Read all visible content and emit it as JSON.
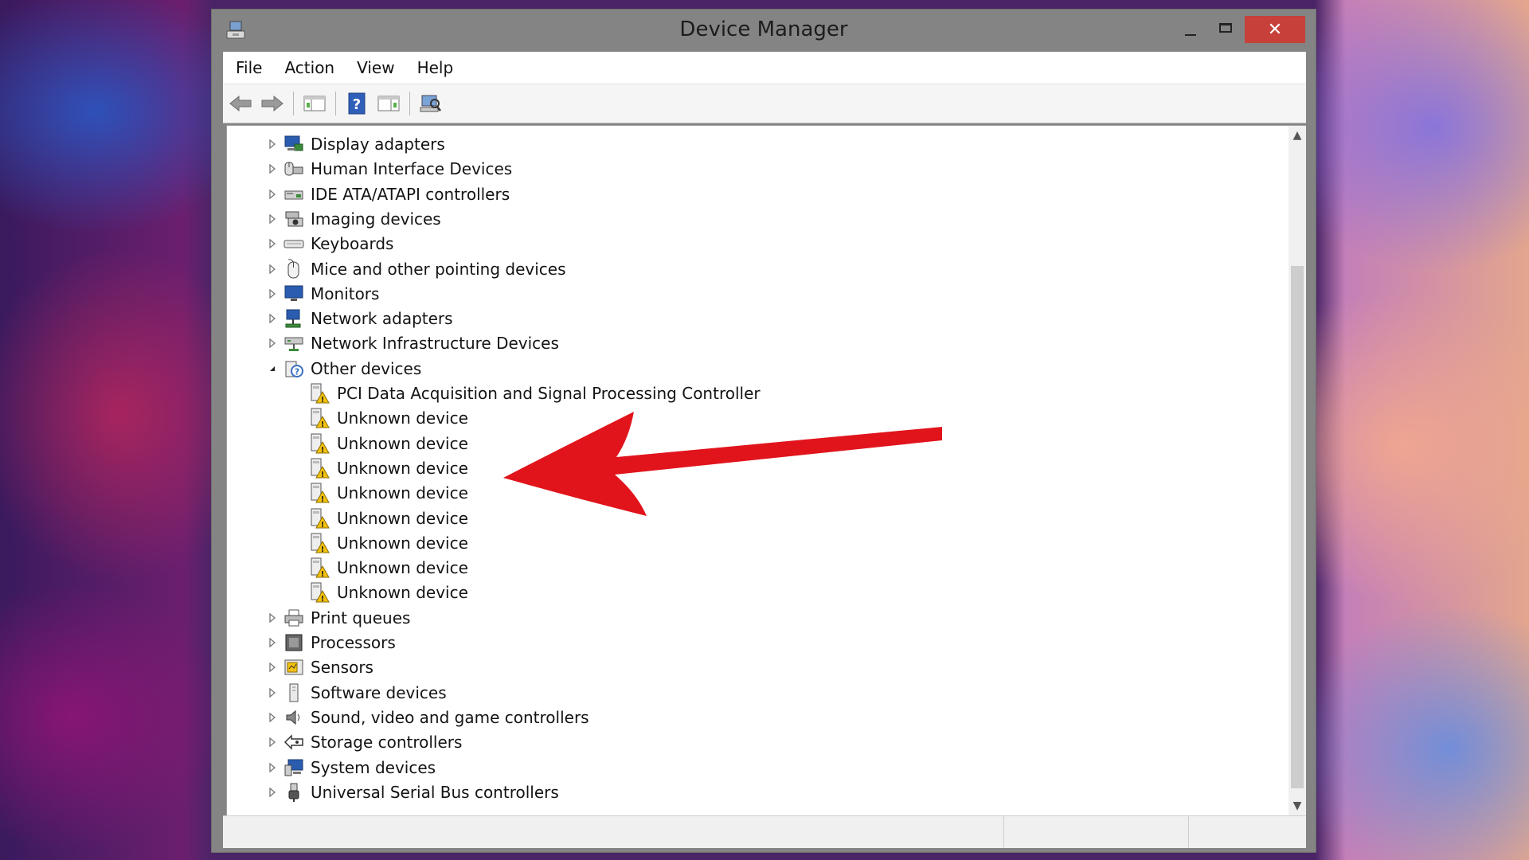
{
  "window": {
    "title": "Device Manager",
    "close_glyph": "✕"
  },
  "menu": [
    {
      "label": "File"
    },
    {
      "label": "Action"
    },
    {
      "label": "View"
    },
    {
      "label": "Help"
    }
  ],
  "toolbar": {
    "icons": [
      "back-arrow-icon",
      "forward-arrow-icon",
      "show-hide-console-tree-icon",
      "help-icon",
      "properties-pane-icon",
      "scan-hardware-icon"
    ]
  },
  "tree": {
    "categories_before": [
      {
        "label": "Display adapters",
        "icon": "display-adapter-icon"
      },
      {
        "label": "Human Interface Devices",
        "icon": "hid-icon"
      },
      {
        "label": "IDE ATA/ATAPI controllers",
        "icon": "ide-controller-icon"
      },
      {
        "label": "Imaging devices",
        "icon": "camera-icon"
      },
      {
        "label": "Keyboards",
        "icon": "keyboard-icon"
      },
      {
        "label": "Mice and other pointing devices",
        "icon": "mouse-icon"
      },
      {
        "label": "Monitors",
        "icon": "monitor-icon"
      },
      {
        "label": "Network adapters",
        "icon": "network-adapter-icon"
      },
      {
        "label": "Network Infrastructure Devices",
        "icon": "network-infrastructure-icon"
      }
    ],
    "expanded": {
      "label": "Other devices",
      "icon": "unknown-device-category-icon",
      "children": [
        {
          "label": "PCI Data Acquisition and Signal Processing Controller"
        },
        {
          "label": "Unknown device"
        },
        {
          "label": "Unknown device"
        },
        {
          "label": "Unknown device"
        },
        {
          "label": "Unknown device"
        },
        {
          "label": "Unknown device"
        },
        {
          "label": "Unknown device"
        },
        {
          "label": "Unknown device"
        },
        {
          "label": "Unknown device"
        }
      ]
    },
    "categories_after": [
      {
        "label": "Print queues",
        "icon": "printer-icon"
      },
      {
        "label": "Processors",
        "icon": "processor-icon"
      },
      {
        "label": "Sensors",
        "icon": "sensor-icon"
      },
      {
        "label": "Software devices",
        "icon": "software-device-icon"
      },
      {
        "label": "Sound, video and game controllers",
        "icon": "speaker-icon"
      },
      {
        "label": "Storage controllers",
        "icon": "storage-controller-icon"
      },
      {
        "label": "System devices",
        "icon": "system-device-icon"
      },
      {
        "label": "Universal Serial Bus controllers",
        "icon": "usb-icon"
      }
    ]
  },
  "colors": {
    "annotation_arrow": "#e1141c",
    "close_button": "#c7403a",
    "warning_yellow": "#f4c20d"
  }
}
